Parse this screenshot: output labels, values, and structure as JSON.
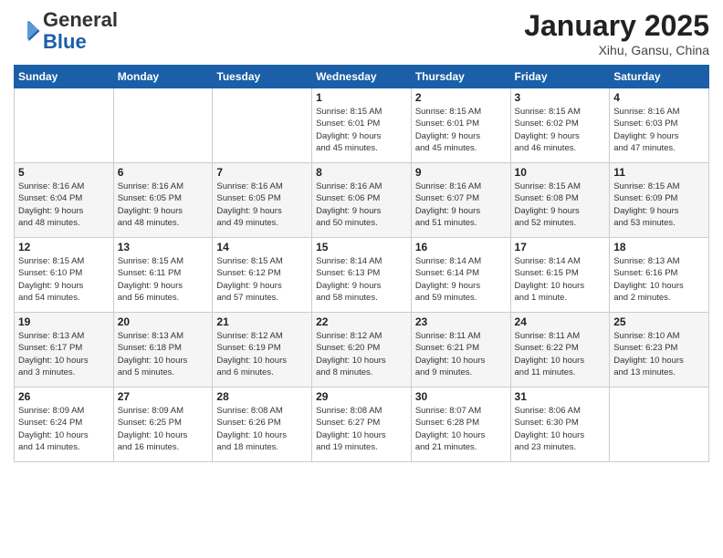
{
  "logo": {
    "general": "General",
    "blue": "Blue"
  },
  "header": {
    "title": "January 2025",
    "location": "Xihu, Gansu, China"
  },
  "weekdays": [
    "Sunday",
    "Monday",
    "Tuesday",
    "Wednesday",
    "Thursday",
    "Friday",
    "Saturday"
  ],
  "weeks": [
    [
      {
        "day": "",
        "info": ""
      },
      {
        "day": "",
        "info": ""
      },
      {
        "day": "",
        "info": ""
      },
      {
        "day": "1",
        "info": "Sunrise: 8:15 AM\nSunset: 6:01 PM\nDaylight: 9 hours\nand 45 minutes."
      },
      {
        "day": "2",
        "info": "Sunrise: 8:15 AM\nSunset: 6:01 PM\nDaylight: 9 hours\nand 45 minutes."
      },
      {
        "day": "3",
        "info": "Sunrise: 8:15 AM\nSunset: 6:02 PM\nDaylight: 9 hours\nand 46 minutes."
      },
      {
        "day": "4",
        "info": "Sunrise: 8:16 AM\nSunset: 6:03 PM\nDaylight: 9 hours\nand 47 minutes."
      }
    ],
    [
      {
        "day": "5",
        "info": "Sunrise: 8:16 AM\nSunset: 6:04 PM\nDaylight: 9 hours\nand 48 minutes."
      },
      {
        "day": "6",
        "info": "Sunrise: 8:16 AM\nSunset: 6:05 PM\nDaylight: 9 hours\nand 48 minutes."
      },
      {
        "day": "7",
        "info": "Sunrise: 8:16 AM\nSunset: 6:05 PM\nDaylight: 9 hours\nand 49 minutes."
      },
      {
        "day": "8",
        "info": "Sunrise: 8:16 AM\nSunset: 6:06 PM\nDaylight: 9 hours\nand 50 minutes."
      },
      {
        "day": "9",
        "info": "Sunrise: 8:16 AM\nSunset: 6:07 PM\nDaylight: 9 hours\nand 51 minutes."
      },
      {
        "day": "10",
        "info": "Sunrise: 8:15 AM\nSunset: 6:08 PM\nDaylight: 9 hours\nand 52 minutes."
      },
      {
        "day": "11",
        "info": "Sunrise: 8:15 AM\nSunset: 6:09 PM\nDaylight: 9 hours\nand 53 minutes."
      }
    ],
    [
      {
        "day": "12",
        "info": "Sunrise: 8:15 AM\nSunset: 6:10 PM\nDaylight: 9 hours\nand 54 minutes."
      },
      {
        "day": "13",
        "info": "Sunrise: 8:15 AM\nSunset: 6:11 PM\nDaylight: 9 hours\nand 56 minutes."
      },
      {
        "day": "14",
        "info": "Sunrise: 8:15 AM\nSunset: 6:12 PM\nDaylight: 9 hours\nand 57 minutes."
      },
      {
        "day": "15",
        "info": "Sunrise: 8:14 AM\nSunset: 6:13 PM\nDaylight: 9 hours\nand 58 minutes."
      },
      {
        "day": "16",
        "info": "Sunrise: 8:14 AM\nSunset: 6:14 PM\nDaylight: 9 hours\nand 59 minutes."
      },
      {
        "day": "17",
        "info": "Sunrise: 8:14 AM\nSunset: 6:15 PM\nDaylight: 10 hours\nand 1 minute."
      },
      {
        "day": "18",
        "info": "Sunrise: 8:13 AM\nSunset: 6:16 PM\nDaylight: 10 hours\nand 2 minutes."
      }
    ],
    [
      {
        "day": "19",
        "info": "Sunrise: 8:13 AM\nSunset: 6:17 PM\nDaylight: 10 hours\nand 3 minutes."
      },
      {
        "day": "20",
        "info": "Sunrise: 8:13 AM\nSunset: 6:18 PM\nDaylight: 10 hours\nand 5 minutes."
      },
      {
        "day": "21",
        "info": "Sunrise: 8:12 AM\nSunset: 6:19 PM\nDaylight: 10 hours\nand 6 minutes."
      },
      {
        "day": "22",
        "info": "Sunrise: 8:12 AM\nSunset: 6:20 PM\nDaylight: 10 hours\nand 8 minutes."
      },
      {
        "day": "23",
        "info": "Sunrise: 8:11 AM\nSunset: 6:21 PM\nDaylight: 10 hours\nand 9 minutes."
      },
      {
        "day": "24",
        "info": "Sunrise: 8:11 AM\nSunset: 6:22 PM\nDaylight: 10 hours\nand 11 minutes."
      },
      {
        "day": "25",
        "info": "Sunrise: 8:10 AM\nSunset: 6:23 PM\nDaylight: 10 hours\nand 13 minutes."
      }
    ],
    [
      {
        "day": "26",
        "info": "Sunrise: 8:09 AM\nSunset: 6:24 PM\nDaylight: 10 hours\nand 14 minutes."
      },
      {
        "day": "27",
        "info": "Sunrise: 8:09 AM\nSunset: 6:25 PM\nDaylight: 10 hours\nand 16 minutes."
      },
      {
        "day": "28",
        "info": "Sunrise: 8:08 AM\nSunset: 6:26 PM\nDaylight: 10 hours\nand 18 minutes."
      },
      {
        "day": "29",
        "info": "Sunrise: 8:08 AM\nSunset: 6:27 PM\nDaylight: 10 hours\nand 19 minutes."
      },
      {
        "day": "30",
        "info": "Sunrise: 8:07 AM\nSunset: 6:28 PM\nDaylight: 10 hours\nand 21 minutes."
      },
      {
        "day": "31",
        "info": "Sunrise: 8:06 AM\nSunset: 6:30 PM\nDaylight: 10 hours\nand 23 minutes."
      },
      {
        "day": "",
        "info": ""
      }
    ]
  ]
}
